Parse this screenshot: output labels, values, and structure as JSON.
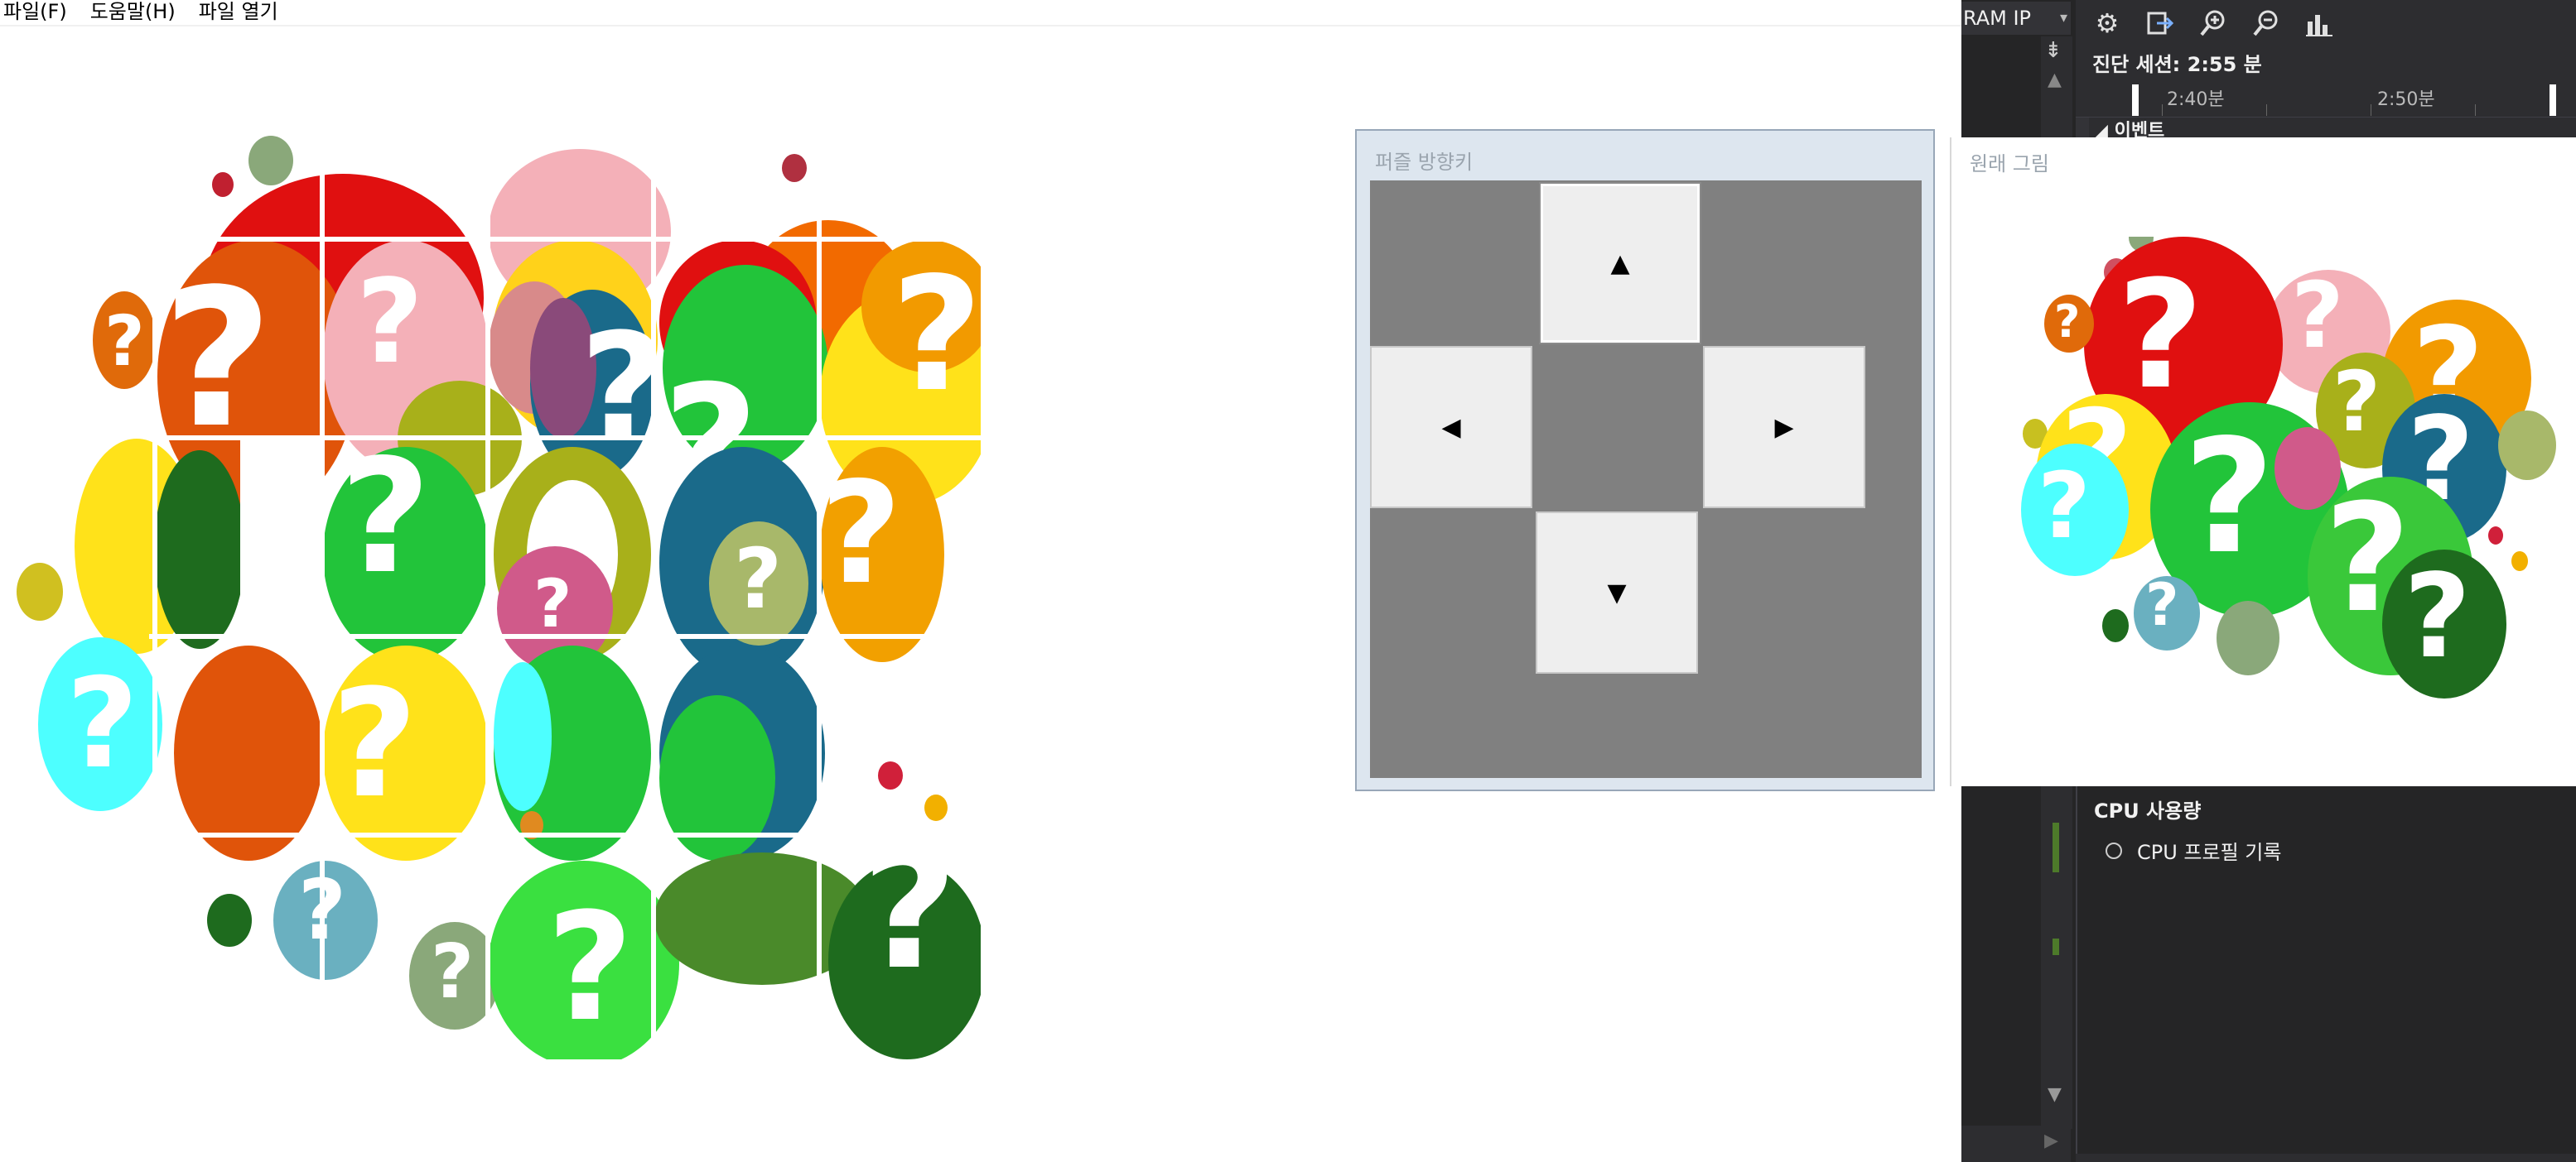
{
  "menu": {
    "items": [
      "파일(F)",
      "도움말(H)",
      "파일 열기"
    ]
  },
  "direction_window": {
    "title": "퍼즐 방향키",
    "buttons": {
      "up": "▲",
      "left": "◀",
      "right": "▶",
      "down": "▼"
    }
  },
  "original_window": {
    "title": "원래 그림"
  },
  "ide": {
    "combo_text": "RAM IP",
    "session_label": "진단 세션: 2:55 분",
    "ruler": {
      "tick1": "2:40분",
      "tick2": "2:50분"
    },
    "events_label": "이벤트",
    "cpu_title": "CPU 사용량",
    "cpu_record": "CPU 프로필 기록",
    "toolbar_icons": [
      "gear-icon",
      "export-icon",
      "zoom-in-icon",
      "zoom-out-icon",
      "chart-icon"
    ]
  },
  "colors": {
    "red": "#e01010",
    "orange": "#f26a00",
    "yellow": "#ffe21a",
    "green": "#22c43a",
    "darkgreen": "#1e6b1e",
    "teal": "#1a6a8a",
    "cyan": "#4dffff",
    "pink": "#f4b0b8",
    "olive": "#a8b01a",
    "magenta": "#d05a8a",
    "sage": "#8aa87a",
    "ide_bg": "#2d2d30",
    "panel_gray": "#808080"
  }
}
